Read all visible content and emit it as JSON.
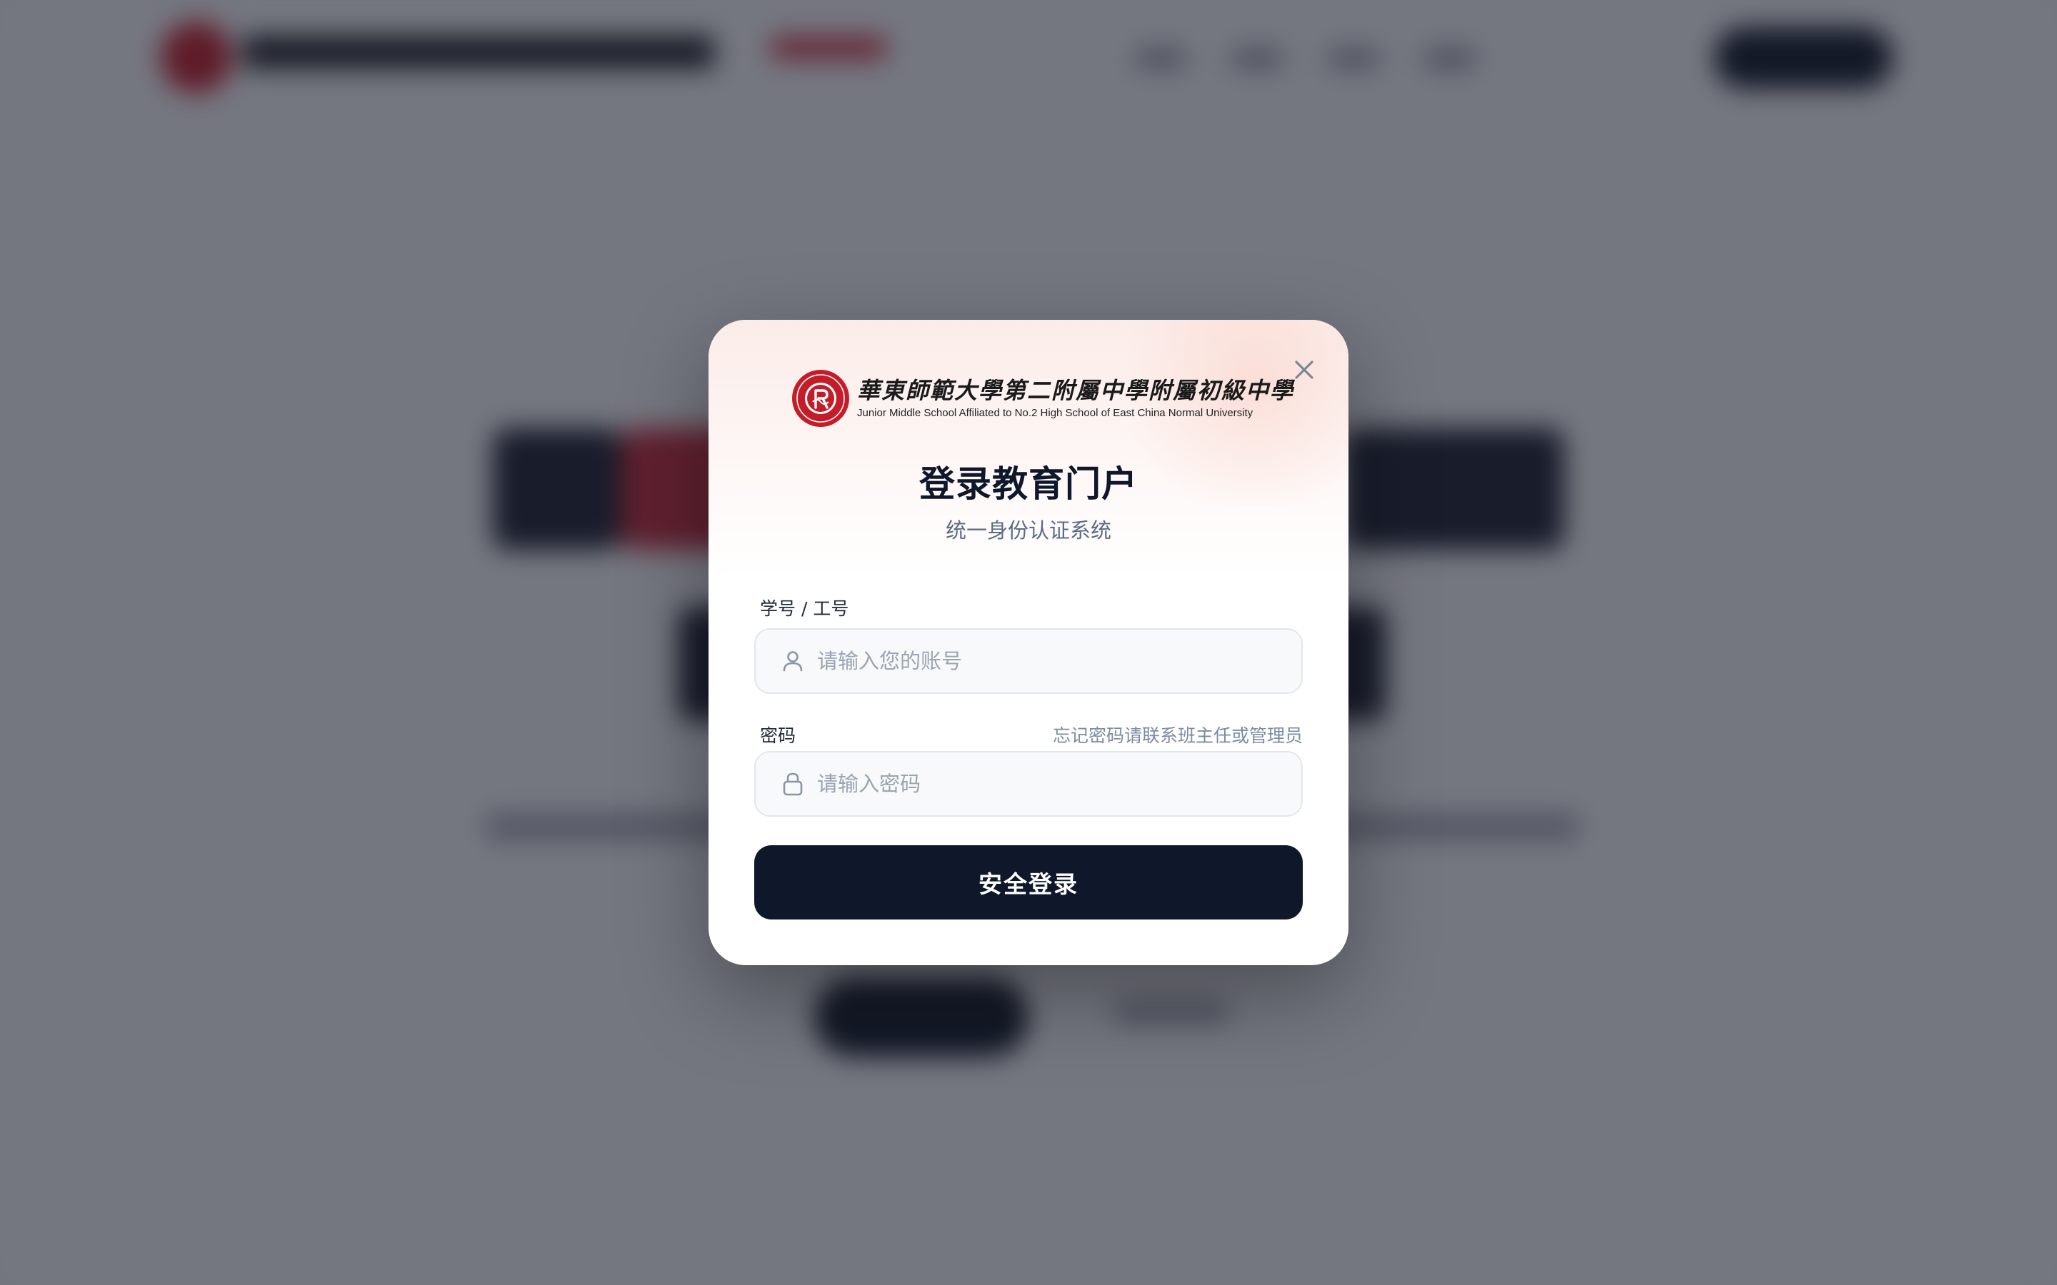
{
  "modal": {
    "brand": {
      "seal_icon": "school-seal-icon",
      "name_cn": "華東師範大學第二附屬中學附屬初級中學",
      "name_en": "Junior Middle School Affiliated to No.2 High School of East China Normal University"
    },
    "title": "登录教育门户",
    "subtitle": "统一身份认证系统",
    "close_icon": "close-icon",
    "account": {
      "label": "学号 / 工号",
      "placeholder": "请输入您的账号",
      "value": "",
      "icon": "user-icon"
    },
    "password": {
      "label": "密码",
      "placeholder": "请输入密码",
      "value": "",
      "icon": "lock-icon",
      "forgot_text": "忘记密码请联系班主任或管理员"
    },
    "submit_label": "安全登录"
  },
  "colors": {
    "primary": "#0f172a",
    "seal_red": "#c41d2a",
    "muted": "#5b6b84",
    "overlay": "#161a28"
  }
}
